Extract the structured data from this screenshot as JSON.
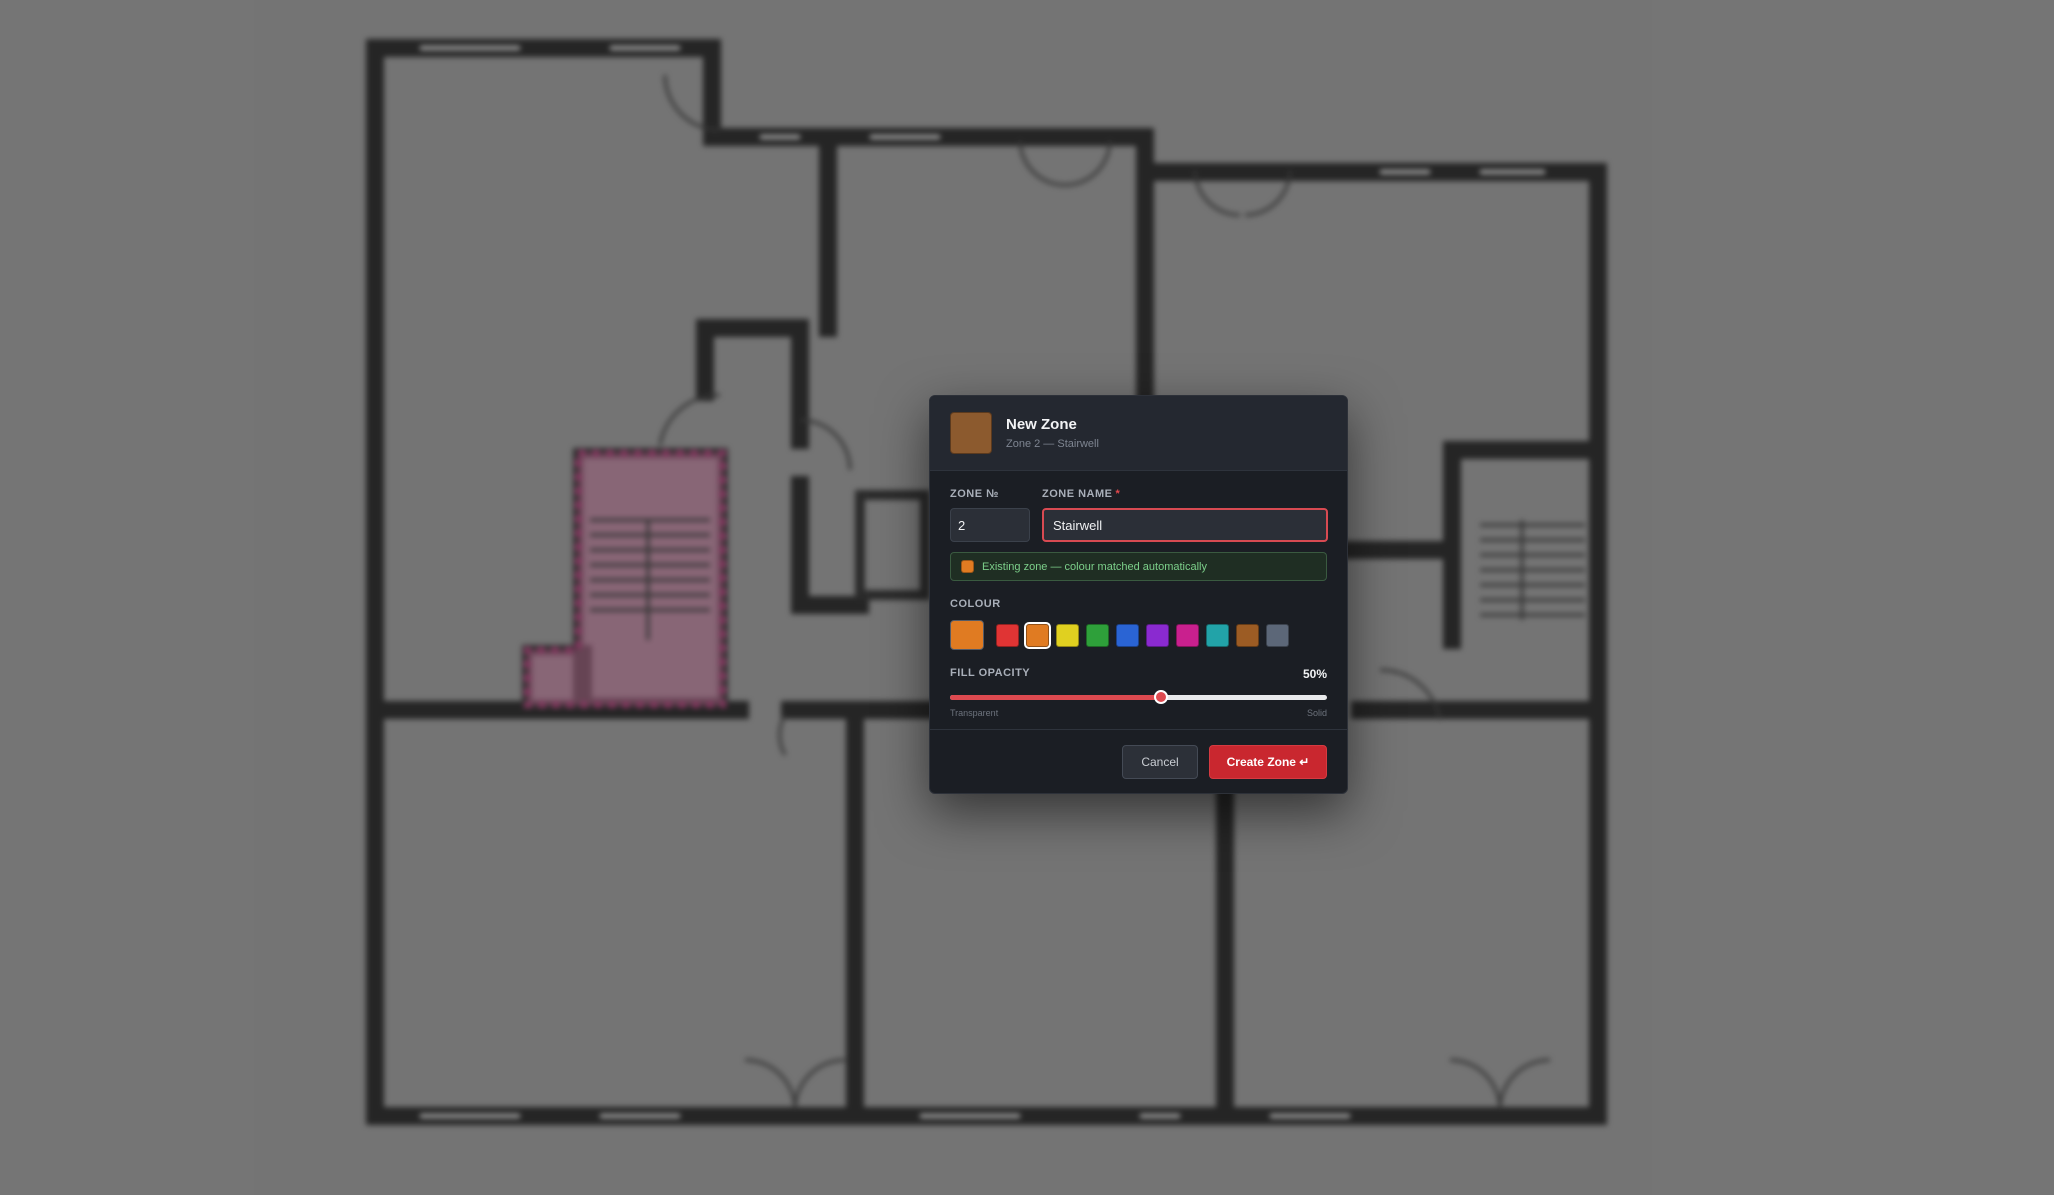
{
  "modal": {
    "title": "New Zone",
    "subtitle": "Zone 2 — Stairwell",
    "header_swatch_color": "#8c5a2e"
  },
  "form": {
    "zone_number_label": "ZONE №",
    "zone_number_value": "2",
    "zone_name_label": "ZONE NAME",
    "zone_name_required": "*",
    "zone_name_value": "Stairwell"
  },
  "match_banner": {
    "text": "Existing zone — colour matched automatically",
    "swatch_color": "#e07b22"
  },
  "colour": {
    "label": "COLOUR",
    "current": "#e07b22",
    "selected_index": 1,
    "palette": [
      "#e03434",
      "#e07b22",
      "#e0d020",
      "#2ea03a",
      "#2a64d4",
      "#8a2ad0",
      "#c9208e",
      "#22a3a8",
      "#9c5c24",
      "#5c6778"
    ]
  },
  "opacity": {
    "label": "FILL OPACITY",
    "value_text": "50%",
    "value": 0.56,
    "min_label": "Transparent",
    "max_label": "Solid"
  },
  "footer": {
    "cancel_label": "Cancel",
    "create_label": "Create Zone ↵"
  },
  "colors": {
    "accent": "#c9272f",
    "zone_highlight": "#a3557a"
  }
}
